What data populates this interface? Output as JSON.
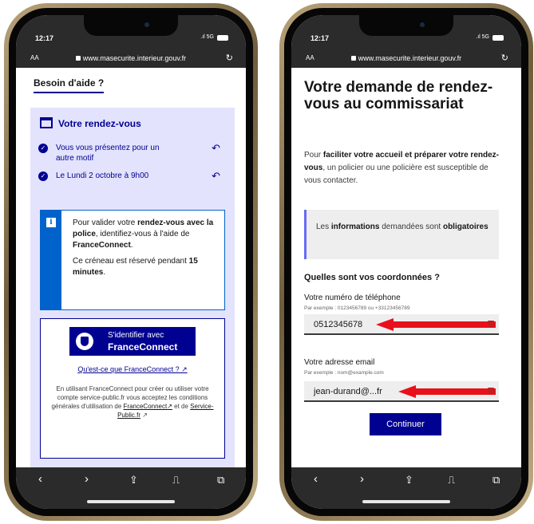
{
  "status": {
    "time": "12:17",
    "network": "5G"
  },
  "browser": {
    "aa_label": "AA",
    "url": "www.masecurite.interieur.gouv.fr"
  },
  "left": {
    "help_title": "Besoin d'aide ?",
    "rdv_title": "Votre rendez-vous",
    "items": [
      {
        "text": "Vous vous présentez pour un autre motif"
      },
      {
        "text": "Le Lundi 2 octobre à 9h00"
      }
    ],
    "info": {
      "p1_a": "Pour valider votre ",
      "p1_b": "rendez-vous avec la police",
      "p1_c": ", identifiez-vous à l'aide de ",
      "p1_d": "FranceConnect",
      "p1_e": ".",
      "p2_a": "Ce créneau est réservé pendant ",
      "p2_b": "15 minutes",
      "p2_c": "."
    },
    "franceconnect": {
      "btn_line1": "S'identifier avec",
      "btn_line2": "FranceConnect",
      "link": "Qu'est-ce que FranceConnect ? ↗",
      "text_1": "En utilisant FranceConnect pour créer ou utiliser votre compte service-public.fr vous acceptez les conditions générales d'utilisation de ",
      "link_fc": "FranceConnect↗",
      "text_2": " et de ",
      "link_sp": "Service-Public.fr",
      "text_3": " ↗"
    }
  },
  "right": {
    "title": "Votre demande de rendez-vous au commissariat",
    "intro_a": "Pour ",
    "intro_b": "faciliter votre accueil et préparer votre rendez-vous",
    "intro_c": ", un policier ou une policière est susceptible de vous contacter.",
    "callout_a": "Les ",
    "callout_b": "informations",
    "callout_c": " demandées sont ",
    "callout_d": "obligatoires",
    "question": "Quelles sont vos coordonnées ?",
    "phone_label": "Votre numéro de téléphone",
    "phone_hint": "Par exemple : 0123456789 ou +33123456789",
    "phone_value": "0512345678",
    "email_label": "Votre adresse email",
    "email_hint": "Par exemple : nom@example.com",
    "email_value": "jean-durand@...fr",
    "continue": "Continuer"
  },
  "colors": {
    "primary": "#000091",
    "info": "#0063cb",
    "arrow": "#e8101a",
    "frame": "#b8a37a"
  },
  "icons": [
    "calendar-icon",
    "check-icon",
    "undo-icon",
    "info-icon",
    "franceconnect-logo",
    "external-link-icon",
    "back-icon",
    "forward-icon",
    "share-icon",
    "bookmarks-icon",
    "tabs-icon",
    "reload-icon",
    "lock-icon",
    "password-manager-icon"
  ]
}
